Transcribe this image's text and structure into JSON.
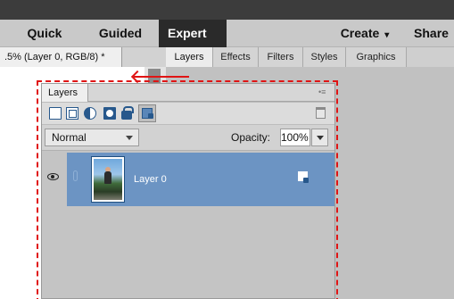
{
  "mode_bar": {
    "tabs": [
      {
        "label": "Quick"
      },
      {
        "label": "Guided"
      },
      {
        "label": "Expert",
        "active": true
      },
      {
        "label": "Create"
      },
      {
        "label": "Share"
      }
    ],
    "create_caret": "▾"
  },
  "document_tab": {
    "title": ".5% (Layer 0, RGB/8) *"
  },
  "panel_tabs": [
    {
      "label": "Layers",
      "active": true
    },
    {
      "label": "Effects"
    },
    {
      "label": "Filters"
    },
    {
      "label": "Styles"
    },
    {
      "label": "Graphics"
    }
  ],
  "layers_panel": {
    "title": "Layers",
    "menu_icon": "panel-menu-icon",
    "toolbar_icons": [
      "new-layer-icon",
      "new-group-icon",
      "adjustment-layer-icon",
      "layer-mask-icon",
      "lock-icon",
      "lock-all-icon",
      "trash-icon"
    ],
    "blend_mode": "Normal",
    "opacity_label": "Opacity:",
    "opacity_value": "100%",
    "layers": [
      {
        "name": "Layer 0",
        "visible": true,
        "selected": true
      }
    ]
  },
  "colors": {
    "annotation": "#e01414",
    "selected_layer": "#6c94c3",
    "expert_tab": "#2a2a2a"
  }
}
